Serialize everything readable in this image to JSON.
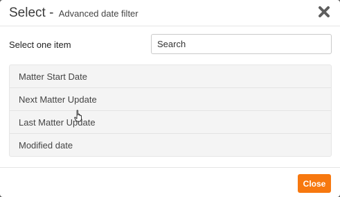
{
  "dialog": {
    "title": "Select -",
    "subtitle": "Advanced date filter",
    "close_icon": "close-x-icon"
  },
  "select_label": "Select one item",
  "search": {
    "value": "",
    "placeholder": "Search"
  },
  "items": [
    {
      "label": "Matter Start Date"
    },
    {
      "label": "Next Matter Update"
    },
    {
      "label": "Last Matter Update"
    },
    {
      "label": "Modified date"
    }
  ],
  "footer": {
    "close_label": "Close",
    "close_color": "#f7780f"
  },
  "cursor_icon": "hand-pointer-icon"
}
